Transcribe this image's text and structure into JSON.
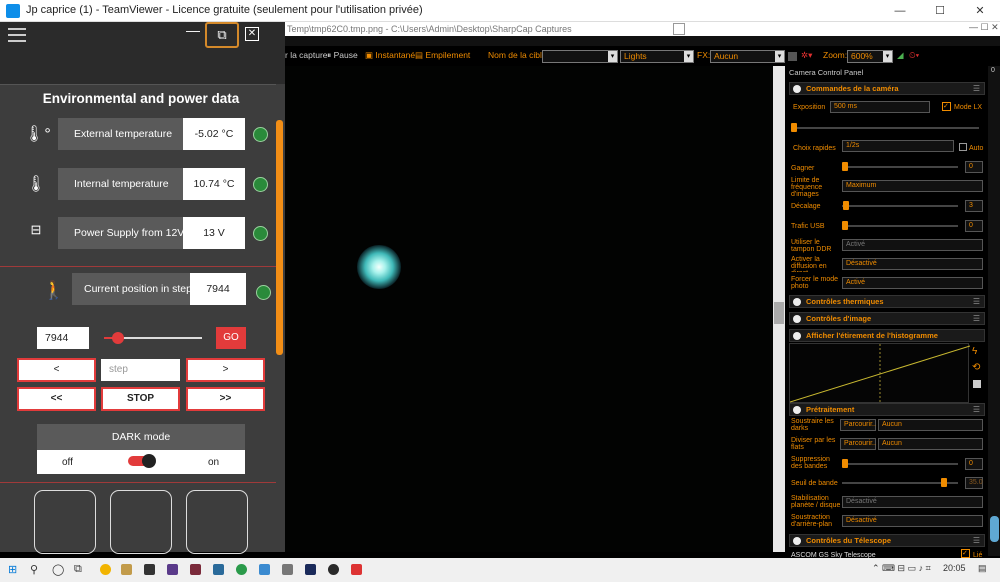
{
  "tv_title": "Jp caprice (1) - TeamViewer - Licence gratuite (seulement pour l'utilisation privée)",
  "window_controls": {
    "min": "—",
    "max": "☐",
    "close": "✕"
  },
  "sharpcap": {
    "path": "Temp\\tmp62C0.tmp.png - C:\\Users\\Admin\\Desktop\\SharpCap Captures",
    "toolbar": {
      "capture": "r la capture",
      "pause": "Pause",
      "snapshot": "Instantané",
      "stack": "Empilement",
      "target_label": "Nom de la cible:",
      "target_value": "",
      "frame_type": "Lights",
      "fx_label": "FX:",
      "fx_value": "Aucun",
      "zoom_label": "Zoom:",
      "zoom_value": "600%"
    },
    "panel": {
      "title": "Camera Control Panel",
      "sections": {
        "camera": "Commandes de la caméra",
        "thermal": "Contrôles thermiques",
        "image": "Contrôles d'image",
        "histogram": "Afficher l'étirement de l'histogramme",
        "preprocess": "Prétraitement",
        "telescope": "Contrôles du Télescope"
      },
      "exposure_label": "Exposition",
      "exposure_value": "500 ms",
      "lx_label": "Mode LX",
      "quick_label": "Choix rapides",
      "quick_value": "1/2s",
      "auto_label": "Auto",
      "gain_label": "Gagner",
      "gain_value": "0",
      "framerate_label": "Limite de fréquence d'images",
      "framerate_value": "Maximum",
      "offset_label": "Décalage",
      "offset_value": "3",
      "usb_label": "Trafic USB",
      "usb_value": "0",
      "ddr_label": "Utiliser le tampon DDR",
      "ddr_value": "Activé",
      "diffusion_label": "Activer la diffusion en direct",
      "diffusion_value": "Désactivé",
      "force_label": "Forcer le mode photo",
      "force_value": "Activé",
      "darks_label": "Soustraire les darks",
      "darks_browse": "Parcourir..",
      "darks_value": "Aucun",
      "flats_label": "Diviser par les flats",
      "flats_browse": "Parcourir..",
      "flats_value": "Aucun",
      "banding_label": "Suppression des bandes",
      "banding_value": "0",
      "threshold_label": "Seuil de bande",
      "threshold_value": "35.0",
      "stab_label": "Stabilisation planète / disque",
      "stab_value": "Désactivé",
      "bg_label": "Soustraction d'arrière-plan",
      "bg_value": "Désactivé",
      "telescope_value": "ASCOM GS Sky Telescope",
      "telescope_link": "Lié",
      "scroll_label": "0"
    }
  },
  "app": {
    "header_title": "Environmental and power data",
    "ext": {
      "label": "External temperature",
      "value": "-5.02 °C"
    },
    "int": {
      "label": "Internal temperature",
      "value": "10.74 °C"
    },
    "psu": {
      "label": "Power Supply from 12V",
      "value": "13 V"
    },
    "pos": {
      "label": "Current position in step",
      "value": "7944"
    },
    "move": {
      "input": "7944",
      "go": "GO",
      "left": "<",
      "right": ">",
      "step_placeholder": "step",
      "fast_left": "<<",
      "stop": "STOP",
      "fast_right": ">>"
    },
    "dark": {
      "title": "DARK mode",
      "off": "off",
      "on": "on"
    },
    "slider_fraction": 0.08
  },
  "taskbar": {
    "time": "20:05"
  }
}
